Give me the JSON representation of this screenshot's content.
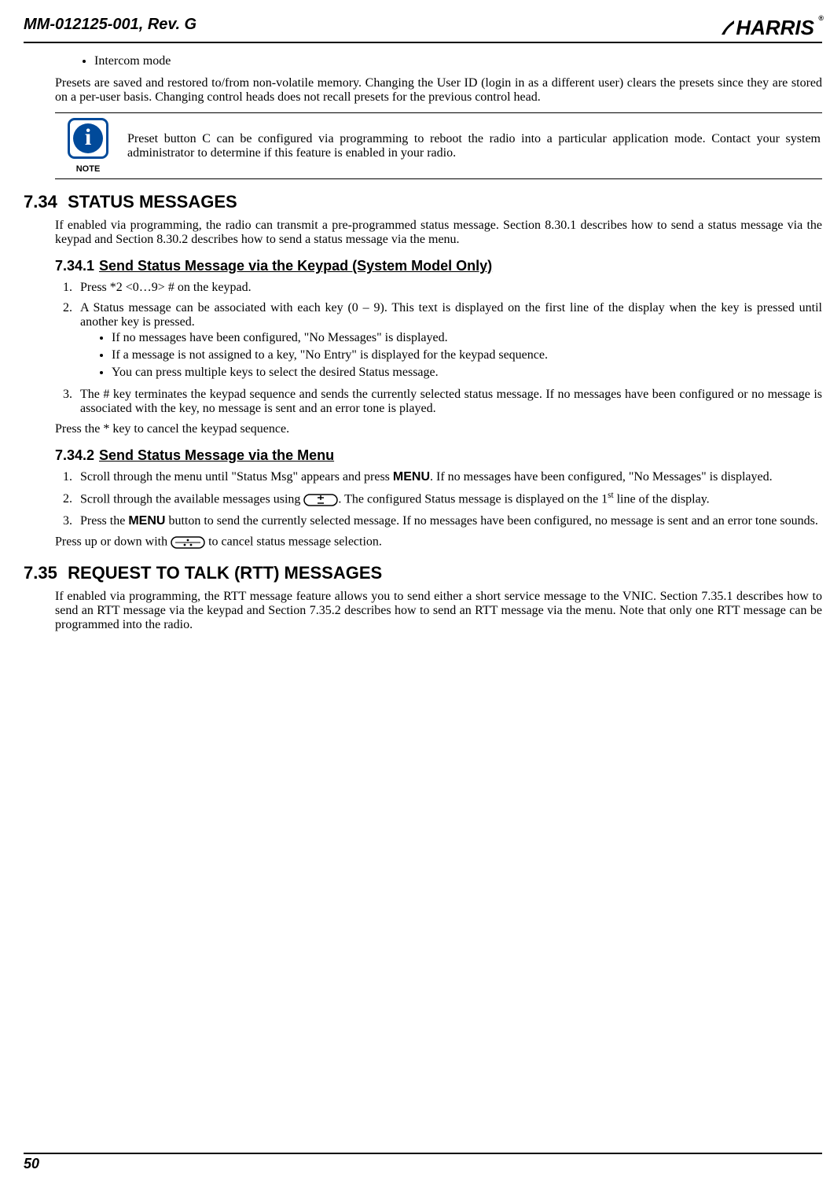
{
  "header": {
    "doc_id": "MM-012125-001, Rev. G",
    "brand": "HARRIS",
    "brand_mark": "®"
  },
  "intro": {
    "bullet1": "Intercom mode",
    "para1": "Presets are saved and restored to/from non-volatile memory. Changing the User ID (login in as a different user) clears the presets since they are stored on a per-user basis. Changing control heads does not recall presets for the previous control head."
  },
  "note": {
    "label": "NOTE",
    "text": "Preset button C can be configured via programming to reboot the radio into a particular application mode. Contact your system administrator to determine if this feature is enabled in your radio."
  },
  "sec734": {
    "num": "7.34",
    "title": "STATUS MESSAGES",
    "intro": "If enabled via programming, the radio can transmit a pre-programmed status message. Section 8.30.1 describes how to send a status message via the keypad and Section 8.30.2 describes how to send a status message via the menu.",
    "sub1": {
      "num": "7.34.1",
      "title": "Send Status Message via the Keypad (System Model Only)",
      "step1": "Press *2 <0…9> # on the keypad.",
      "step2": "A Status message can be associated with each key (0 – 9). This text is displayed on the first line of the display when the key is pressed until another key is pressed.",
      "step2_b1": "If no messages have been configured, \"No Messages\" is displayed.",
      "step2_b2": "If a message is not assigned to a key, \"No Entry\" is displayed for the keypad sequence.",
      "step2_b3": "You can press multiple keys to select the desired Status message.",
      "step3": "The # key terminates the keypad sequence and sends the currently selected status message. If no messages have been configured or no message is associated with the key, no message is sent and an error tone is played.",
      "cancel": "Press the * key to cancel the keypad sequence."
    },
    "sub2": {
      "num": "7.34.2",
      "title": "Send Status Message via the Menu",
      "step1_a": "Scroll through the menu until \"Status Msg\" appears and press ",
      "step1_menu": "MENU",
      "step1_b": ". If no messages have been configured, \"No Messages\" is displayed.",
      "step2_a": "Scroll through the available messages using ",
      "step2_b": ". The configured Status message is displayed on the 1",
      "step2_c": " line of the display.",
      "step2_ord": "st",
      "step3_a": "Press the ",
      "step3_menu": "MENU",
      "step3_b": " button to send the currently selected message. If no messages have been configured, no message is sent and an error tone sounds.",
      "cancel_a": "Press up or down with ",
      "cancel_b": " to cancel status message selection."
    }
  },
  "sec735": {
    "num": "7.35",
    "title": "REQUEST TO TALK (RTT) MESSAGES",
    "intro": "If enabled via programming, the RTT message feature allows you to send either a short service message to the VNIC. Section 7.35.1 describes how to send an RTT message via the keypad and Section 7.35.2 describes how to send an RTT message via the menu. Note that only one RTT message can be programmed into the radio."
  },
  "footer": {
    "page_num": "50"
  }
}
